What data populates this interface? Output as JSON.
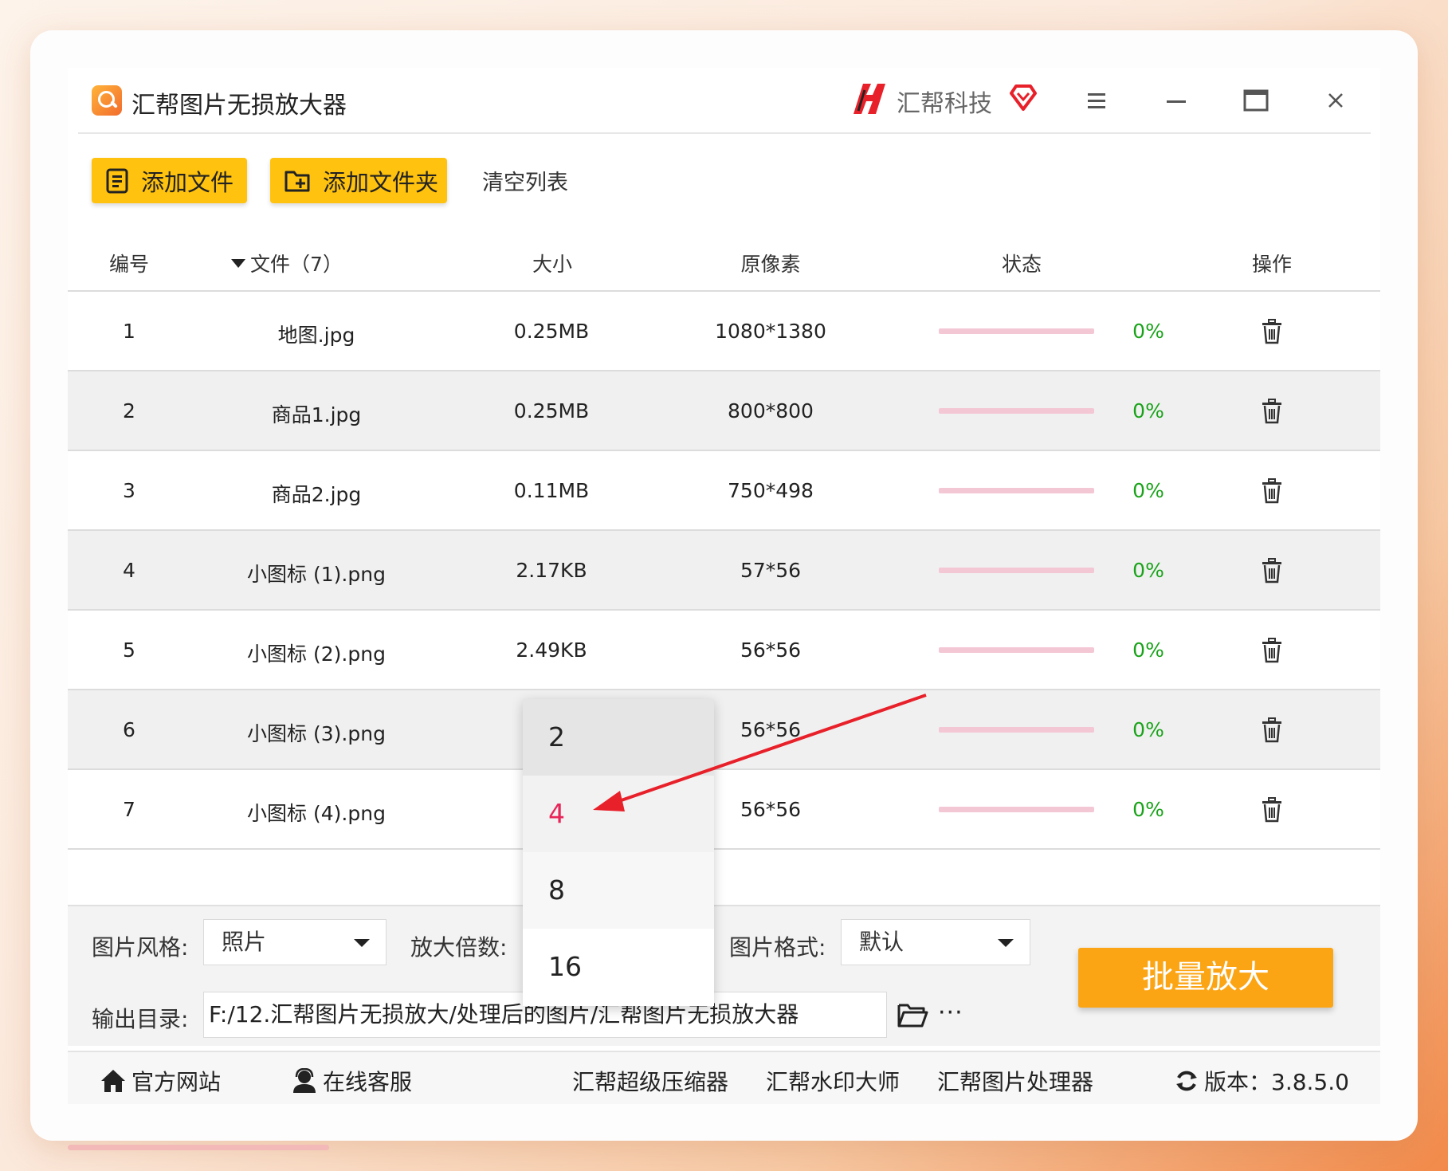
{
  "app": {
    "title": "汇帮图片无损放大器",
    "brand": "汇帮科技"
  },
  "toolbar": {
    "add_file_label": "添加文件",
    "add_folder_label": "添加文件夹",
    "clear_label": "清空列表"
  },
  "table": {
    "headers": {
      "index": "编号",
      "file": "文件（7）",
      "size": "大小",
      "pixels": "原像素",
      "status": "状态",
      "action": "操作"
    },
    "rows": [
      {
        "index": "1",
        "name": "地图.jpg",
        "size": "0.25MB",
        "pixels": "1080*1380",
        "progress": "0%"
      },
      {
        "index": "2",
        "name": "商品1.jpg",
        "size": "0.25MB",
        "pixels": "800*800",
        "progress": "0%"
      },
      {
        "index": "3",
        "name": "商品2.jpg",
        "size": "0.11MB",
        "pixels": "750*498",
        "progress": "0%"
      },
      {
        "index": "4",
        "name": "小图标 (1).png",
        "size": "2.17KB",
        "pixels": "57*56",
        "progress": "0%"
      },
      {
        "index": "5",
        "name": "小图标 (2).png",
        "size": "2.49KB",
        "pixels": "56*56",
        "progress": "0%"
      },
      {
        "index": "6",
        "name": "小图标 (3).png",
        "size": "",
        "pixels": "56*56",
        "progress": "0%"
      },
      {
        "index": "7",
        "name": "小图标 (4).png",
        "size": "",
        "pixels": "56*56",
        "progress": "0%"
      }
    ]
  },
  "settings": {
    "style_label": "图片风格:",
    "style_value": "照片",
    "scale_label": "放大倍数:",
    "format_label": "图片格式:",
    "format_value": "默认",
    "output_label": "输出目录:",
    "output_path": "F:/12.汇帮图片无损放大/处理后的图片/汇帮图片无损放大器",
    "more": "···",
    "batch_button": "批量放大"
  },
  "scale_dropdown": {
    "options": [
      "2",
      "4",
      "8",
      "16"
    ],
    "highlighted": "4"
  },
  "footer": {
    "website": "官方网站",
    "support": "在线客服",
    "link1": "汇帮超级压缩器",
    "link2": "汇帮水印大师",
    "link3": "汇帮图片处理器",
    "version": "版本：3.8.5.0"
  },
  "colors": {
    "accent_yellow": "#ffc20e",
    "batch_orange": "#fca514",
    "progress_green": "#1aa31a",
    "highlight_red": "#e8265a"
  }
}
